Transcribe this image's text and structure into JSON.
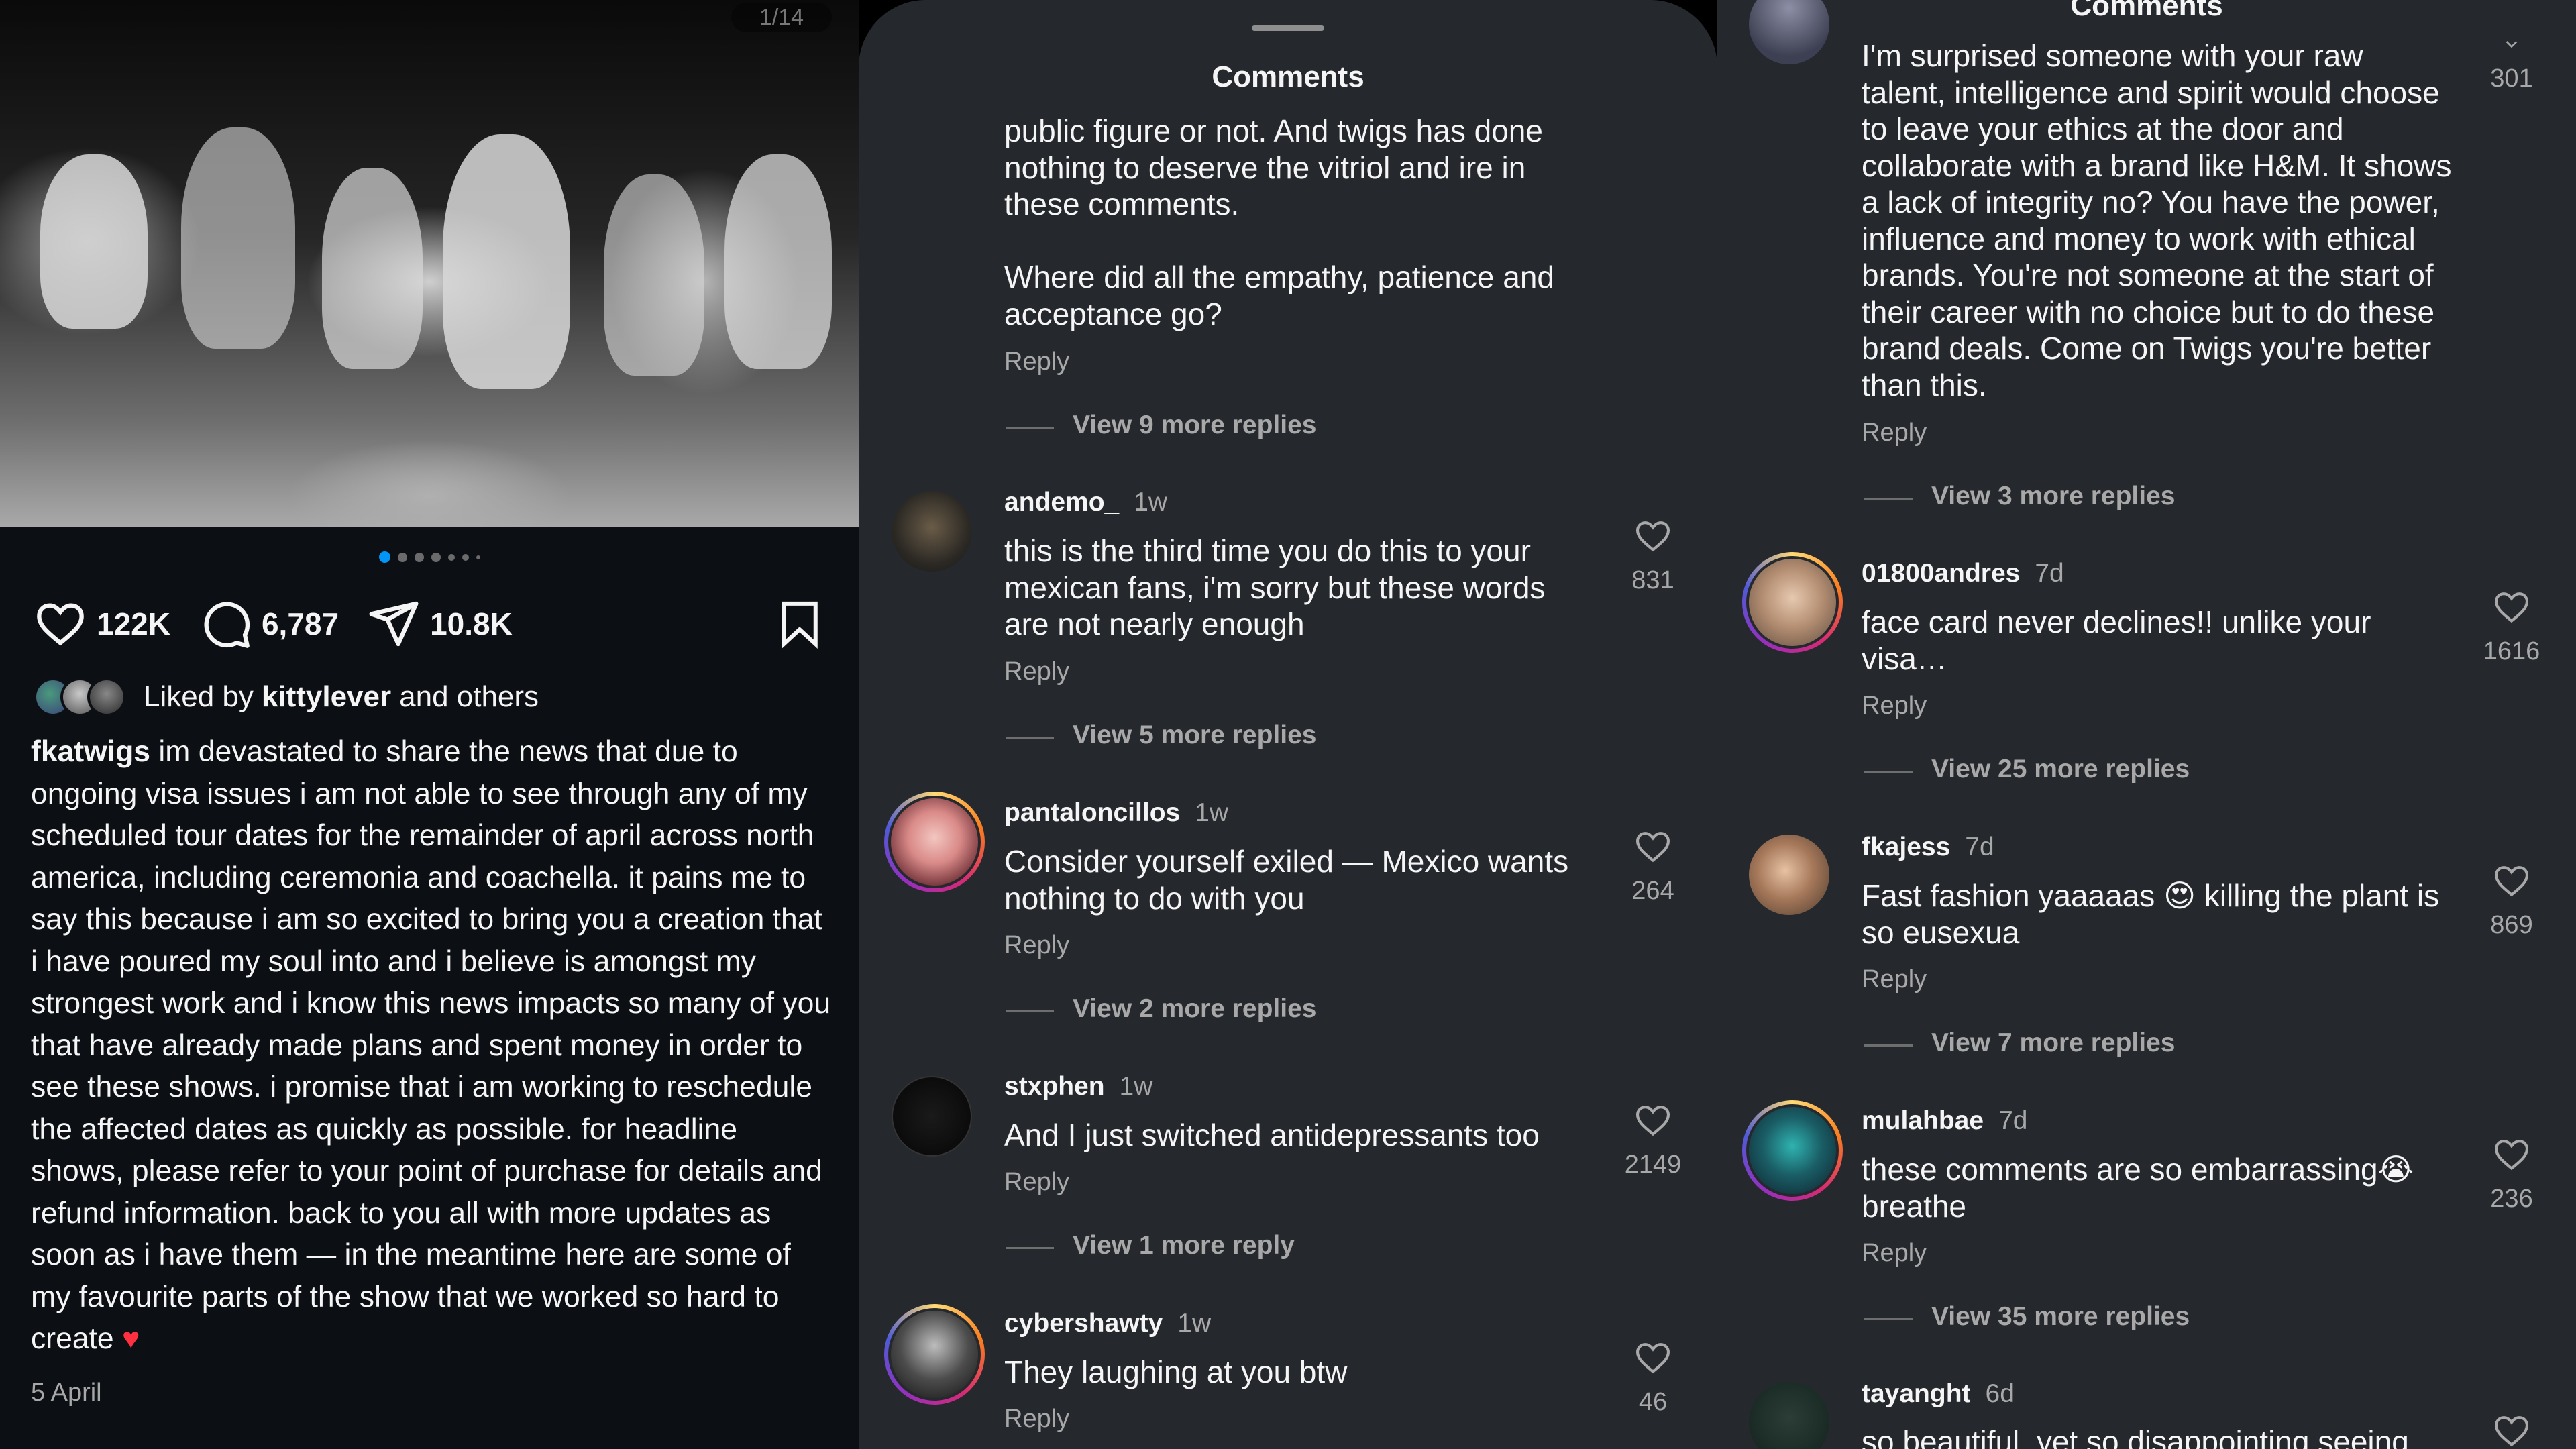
{
  "post": {
    "counter": "1/14",
    "likes": "122K",
    "comments": "6,787",
    "shares": "10.8K",
    "liked_by_prefix": "Liked by",
    "liked_by_user": "kittylever",
    "liked_by_suffix": "and others",
    "author": "fkatwigs",
    "caption": "im devastated to share the news that due to ongoing visa issues i am not able to see through any of my scheduled tour dates for the remainder of april across north america, including ceremonia and coachella. it pains me to say this because i am so excited to bring you a creation that i have poured my soul into and i believe is amongst my strongest work and i know this news impacts so many of you that have already made plans and spent money in order to see these shows. i promise that i am working to reschedule the affected dates as quickly as possible. for headline shows, please refer to your point of purchase for details and refund information. back to you all with more updates as soon as i have them — in the meantime here are some of my favourite parts of the show that we worked so hard to create",
    "caption_emoji": "♥",
    "date": "5 April"
  },
  "sheet_title": "Comments",
  "reply_label": "Reply",
  "panel2": {
    "top_comment_lines": [
      "public figure or not. And twigs has done nothing to deserve the vitriol and ire in these comments.",
      "Where did all the empathy, patience and acceptance go?"
    ],
    "top_view_more": "View 9 more replies",
    "comments": [
      {
        "user": "andemo_",
        "time": "1w",
        "text": "this is the third time you do this to your mexican fans, i'm sorry but these words are not nearly enough",
        "likes": "831",
        "view_more": "View 5 more replies"
      },
      {
        "user": "pantaloncillos",
        "time": "1w",
        "text": "Consider yourself exiled — Mexico wants nothing to do with you",
        "likes": "264",
        "view_more": "View 2 more replies"
      },
      {
        "user": "stxphen",
        "time": "1w",
        "text": "And I just switched antidepressants too",
        "likes": "2149",
        "view_more": "View 1 more reply"
      },
      {
        "user": "cybershawty",
        "time": "1w",
        "text": "They laughing at you btw",
        "likes": "46"
      }
    ]
  },
  "panel3": {
    "top_comment": "I'm surprised someone with your raw talent, intelligence and spirit would choose to leave your ethics at the door and collaborate with a brand like H&M. It shows a lack of integrity no? You have the power, influence and money to work with ethical brands. You're not someone at the start of their career with no choice but to do these brand deals. Come on Twigs you're better than this.",
    "top_likes": "301",
    "top_view_more": "View 3 more replies",
    "comments": [
      {
        "user": "01800andres",
        "time": "7d",
        "text": "face card never declines!! unlike your visa…",
        "likes": "1616",
        "view_more": "View 25 more replies"
      },
      {
        "user": "fkajess",
        "time": "7d",
        "text_a": "Fast fashion yaaaaas",
        "emoji": "😍",
        "text_b": "killing the plant is so eusexua",
        "likes": "869",
        "view_more": "View 7 more replies"
      },
      {
        "user": "mulahbae",
        "time": "7d",
        "text_a": "these comments are so embarrassing",
        "emoji": "😭",
        "text_b": "breathe",
        "likes": "236",
        "view_more": "View 35 more replies"
      },
      {
        "user": "tayanght",
        "time": "6d",
        "text": "so beautiful, yet so disappointing seeing"
      }
    ]
  }
}
